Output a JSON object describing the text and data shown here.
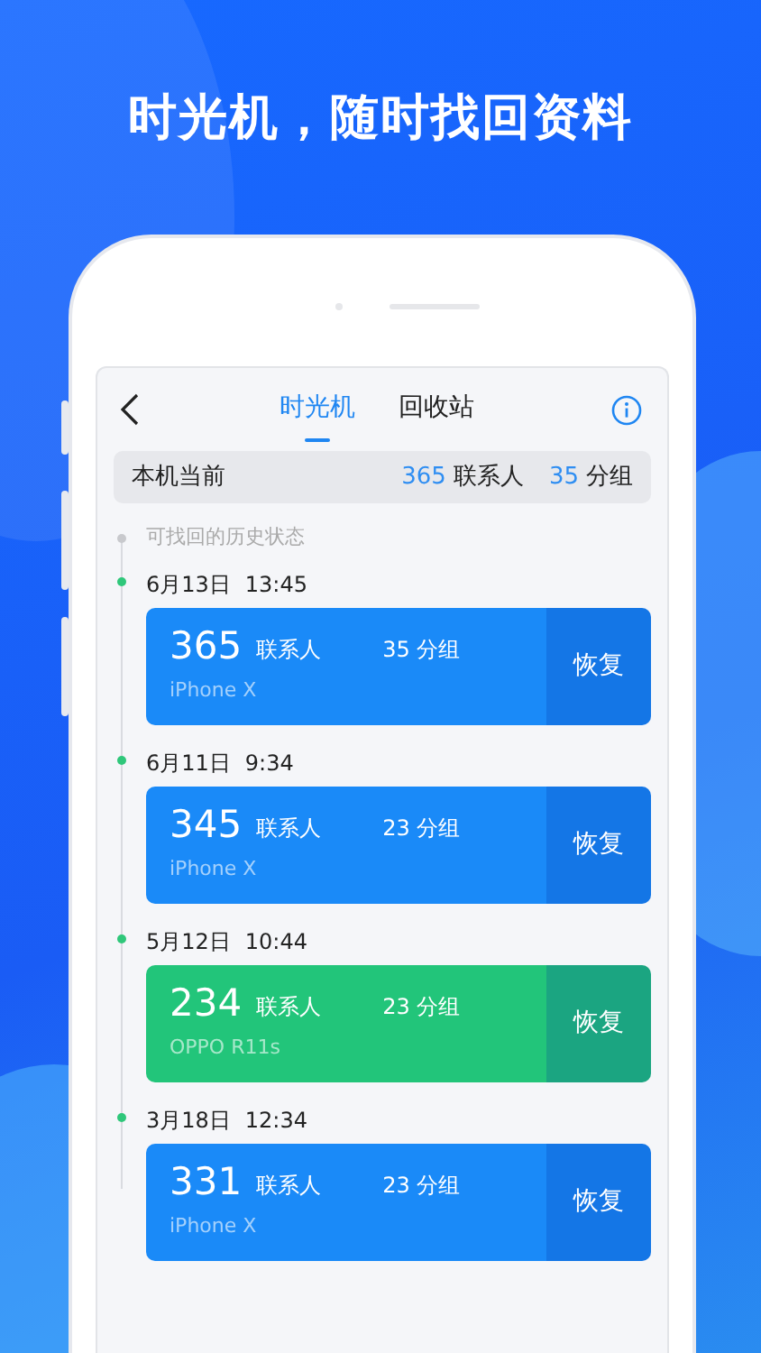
{
  "headline": "时光机，随时找回资料",
  "tabs": [
    {
      "label": "时光机",
      "selected": true
    },
    {
      "label": "回收站",
      "selected": false
    }
  ],
  "summary": {
    "label": "本机当前",
    "contacts_count": "365",
    "contacts_label": "联系人",
    "groups_count": "35",
    "groups_label": "分组"
  },
  "timeline_hint": "可找回的历史状态",
  "snapshots": [
    {
      "date": "6月13日",
      "time": "13:45",
      "contacts_count": "365",
      "contacts_label": "联系人",
      "groups": "35 分组",
      "device": "iPhone X",
      "button": "恢复",
      "color": "#1a8af8"
    },
    {
      "date": "6月11日",
      "time": "9:34",
      "contacts_count": "345",
      "contacts_label": "联系人",
      "groups": "23 分组",
      "device": "iPhone X",
      "button": "恢复",
      "color": "#1a8af8"
    },
    {
      "date": "5月12日",
      "time": "10:44",
      "contacts_count": "234",
      "contacts_label": "联系人",
      "groups": "23 分组",
      "device": "OPPO R11s",
      "button": "恢复",
      "color": "#22c57a"
    },
    {
      "date": "3月18日",
      "time": "12:34",
      "contacts_count": "331",
      "contacts_label": "联系人",
      "groups": "23 分组",
      "device": "iPhone X",
      "button": "恢复",
      "color": "#1a8af8"
    }
  ]
}
